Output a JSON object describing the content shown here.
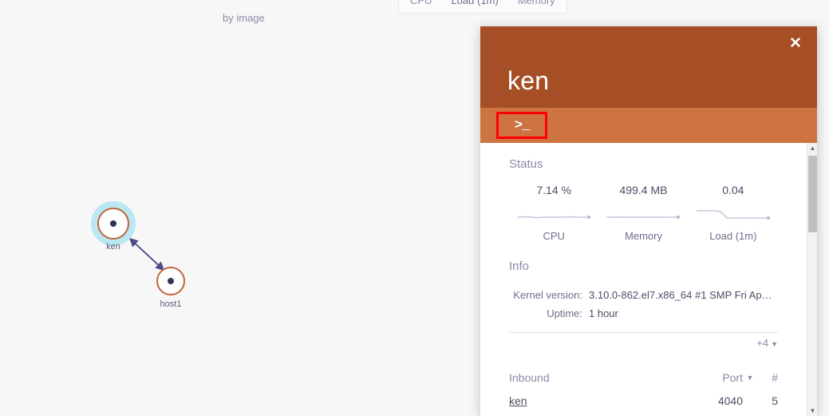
{
  "topbar": {
    "tabs": [
      {
        "label": "CPU"
      },
      {
        "label": "Load (1m)"
      },
      {
        "label": "Memory"
      }
    ],
    "group_by_label": "by image",
    "stub_label": ""
  },
  "graph": {
    "nodes": [
      {
        "id": "ken",
        "label": "ken",
        "selected": true
      },
      {
        "id": "host1",
        "label": "host1",
        "selected": false
      }
    ],
    "edge_direction": "bidirectional",
    "colors": {
      "node_ring": "#c2653b",
      "node_center": "#32325a",
      "selection_halo": "#b9e7f2",
      "edge": "#4a4a8c"
    }
  },
  "panel": {
    "title": "ken",
    "close_label": "✕",
    "terminal_button_glyph": ">_",
    "terminal_button_highlight_color": "#ff0000",
    "header_color": "#a64f26",
    "toolbar_color": "#ce7443",
    "status": {
      "heading": "Status",
      "metrics": [
        {
          "value": "7.14 %",
          "label": "CPU"
        },
        {
          "value": "499.4 MB",
          "label": "Memory"
        },
        {
          "value": "0.04",
          "label": "Load (1m)"
        }
      ]
    },
    "info": {
      "heading": "Info",
      "rows": [
        {
          "key": "Kernel version:",
          "value": "3.10.0-862.el7.x86_64 #1 SMP Fri Ap…"
        },
        {
          "key": "Uptime:",
          "value": "1 hour"
        }
      ],
      "more_label": "+4",
      "more_caret": "▼"
    },
    "inbound": {
      "heading": "Inbound",
      "col_port": "Port",
      "col_sort_caret": "▼",
      "col_count": "#",
      "rows": [
        {
          "name": "ken",
          "port": "4040",
          "count": "5"
        },
        {
          "name": "",
          "port": "",
          "count": ""
        }
      ]
    },
    "scrollbar": {
      "up_arrow": "▲",
      "down_arrow": "▼"
    }
  }
}
